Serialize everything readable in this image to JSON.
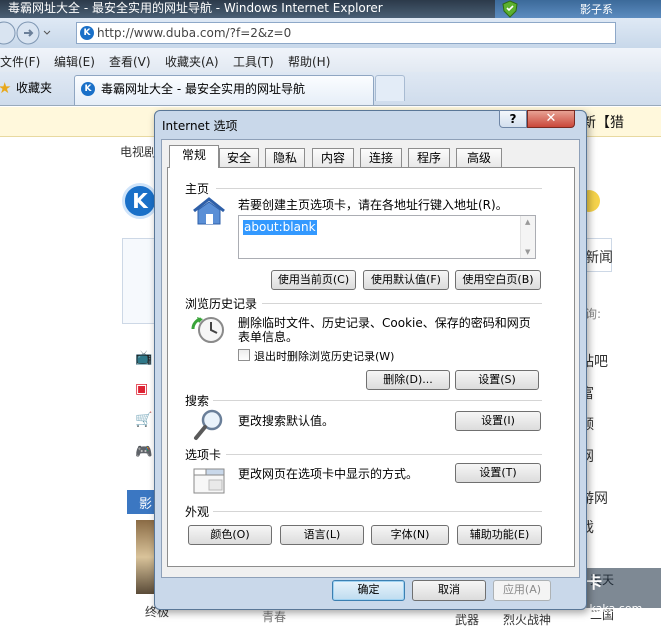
{
  "browser": {
    "window_title": "毒霸网址大全 - 最安全实用的网址导航 - Windows Internet Explorer",
    "title_right_text": "影子系",
    "address": "http://www.duba.com/?f=2&z=0",
    "menu": [
      "文件(F)",
      "编辑(E)",
      "查看(V)",
      "收藏夹(A)",
      "工具(T)",
      "帮助(H)"
    ],
    "favorites_label": "收藏夹",
    "tab_title": "毒霸网址大全 - 最安全实用的网址导航"
  },
  "background_page": {
    "nav_left": "电视剧",
    "tail_text": "新【猎",
    "right_items": [
      "新闻",
      "询:",
      "贴吧",
      "富",
      "频",
      "网",
      "游网",
      "戏",
      "天天",
      "二国"
    ],
    "bottom_items": [
      "终极",
      "青春",
      "武器",
      "烈火战神"
    ],
    "left_tab": "影",
    "watermark": "瑞星卡卡",
    "watermark_url": "www.kaka.com",
    "logo_letter": "K"
  },
  "dialog": {
    "title": "Internet 选项",
    "help_glyph": "?",
    "close_glyph": "✕",
    "tabs": [
      "常规",
      "安全",
      "隐私",
      "内容",
      "连接",
      "程序",
      "高级"
    ],
    "active_tab": "常规",
    "home": {
      "heading": "主页",
      "description": "若要创建主页选项卡，请在各地址行键入地址(R)。",
      "url": "about:blank",
      "btn_current": "使用当前页(C)",
      "btn_default": "使用默认值(F)",
      "btn_blank": "使用空白页(B)"
    },
    "history": {
      "heading": "浏览历史记录",
      "description_line1": "删除临时文件、历史记录、Cookie、保存的密码和网页",
      "description_line2": "表单信息。",
      "checkbox_label": "退出时删除浏览历史记录(W)",
      "checkbox_checked": false,
      "btn_delete": "删除(D)...",
      "btn_settings": "设置(S)"
    },
    "search": {
      "heading": "搜索",
      "description": "更改搜索默认值。",
      "btn_settings": "设置(I)"
    },
    "tabs_section": {
      "heading": "选项卡",
      "description": "更改网页在选项卡中显示的方式。",
      "btn_settings": "设置(T)"
    },
    "appearance": {
      "heading": "外观",
      "btn_colors": "颜色(O)",
      "btn_languages": "语言(L)",
      "btn_fonts": "字体(N)",
      "btn_accessibility": "辅助功能(E)"
    },
    "footer": {
      "ok": "确定",
      "cancel": "取消",
      "apply": "应用(A)"
    }
  }
}
